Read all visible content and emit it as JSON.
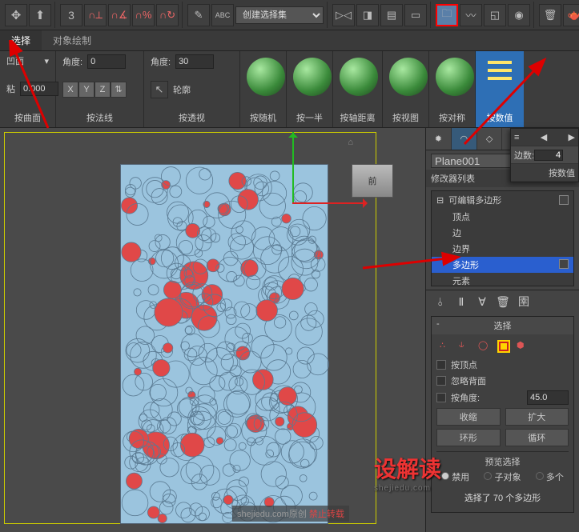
{
  "toolbar": {
    "num3": "3",
    "selectset": "创建选择集",
    "highlight_btn": true
  },
  "ribbon": {
    "tabs": {
      "select": "选择",
      "edit": "对象绘制"
    },
    "sticky": "粘",
    "sticky_val": "0.000",
    "cavity": "凹面",
    "angle_a_lbl": "角度:",
    "angle_a": "0",
    "axes": [
      "X",
      "Y",
      "Z"
    ],
    "angle_b_lbl": "角度:",
    "angle_b": "30",
    "contour": "轮廓",
    "bigbtns": {
      "random": "按随机",
      "half": "按一半",
      "axisdist": "按轴距离",
      "byview": "按视图",
      "symm": "按对称",
      "bynum": "按数值"
    },
    "panes": {
      "curve": "按曲面",
      "normal": "按法线",
      "persp": "按透视"
    }
  },
  "viewport": {
    "cube_face": "前",
    "watermark": "设解读",
    "watermark_sub": "shejiedu.com",
    "footer_wm_a": "shejiedu.com原创",
    "footer_wm_b": "禁止转载"
  },
  "flyout": {
    "edges_lbl": "边数:",
    "edges_val": "4",
    "bynum": "按数值"
  },
  "cmd": {
    "obj_name": "Plane001",
    "modlist_lbl": "修改器列表",
    "stack_head": "可编辑多边形",
    "sub": {
      "vertex": "顶点",
      "edge": "边",
      "border": "边界",
      "poly": "多边形",
      "element": "元素"
    },
    "rollout_select": "选择",
    "by_vertex": "按顶点",
    "ignore_back": "忽略背面",
    "by_angle": "按角度:",
    "by_angle_val": "45.0",
    "shrink": "收缩",
    "grow": "扩大",
    "ring": "环形",
    "loop": "循环",
    "preview_lbl": "预览选择",
    "preview_opts": {
      "off": "禁用",
      "subobj": "子对象",
      "multi": "多个"
    },
    "status": "选择了 70 个多边形"
  },
  "chart_data": null
}
